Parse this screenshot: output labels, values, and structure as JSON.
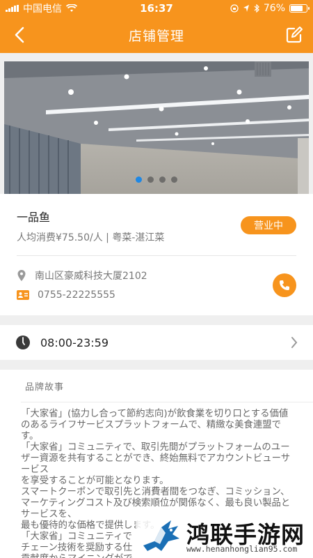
{
  "status_bar": {
    "carrier": "中国电信",
    "time": "16:37",
    "battery": "76%",
    "battery_level": 0.76
  },
  "nav": {
    "title": "店铺管理",
    "back_icon": "chevron-left-icon",
    "edit_icon": "edit-icon"
  },
  "banner": {
    "slide_count": 4,
    "active_index": 0,
    "accent": "#1e88e5"
  },
  "store": {
    "name": "一品鱼",
    "meta": "人均消费¥75.50/人 | 粤菜-湛江菜",
    "status": "营业中",
    "address": "南山区豪威科技大厦2102",
    "phone": "0755-22225555"
  },
  "hours": {
    "text": "08:00-23:59"
  },
  "story": {
    "title": "品牌故事",
    "body": "「大家省」(協力し合って節約志向)が飲食業を切り口とする価値のあるライフサービスプラットフォームで、精緻な美食連盟です。\n「大家省」コミュニティで、取引先間がプラットフォームのユーザー資源を共有することができ、終始無料でアカウントビューサービス\nを享受することが可能となります。\nスマートクーポンで取引先と消費者間をつなぎ、コミッション、マーケティングコスト及び検索順位が関係なく、最も良い製品とサービスを、\n最も優待的な価格で提供します。\n「大家省」コミュニティで\nチェーン技術を奨励する仕\n貢献度からマイニングがで"
  },
  "watermark": {
    "title": "鸿联手游网",
    "url": "www.henanhonglian95.com"
  },
  "colors": {
    "brand": "#f7941d",
    "background": "#efefef"
  }
}
